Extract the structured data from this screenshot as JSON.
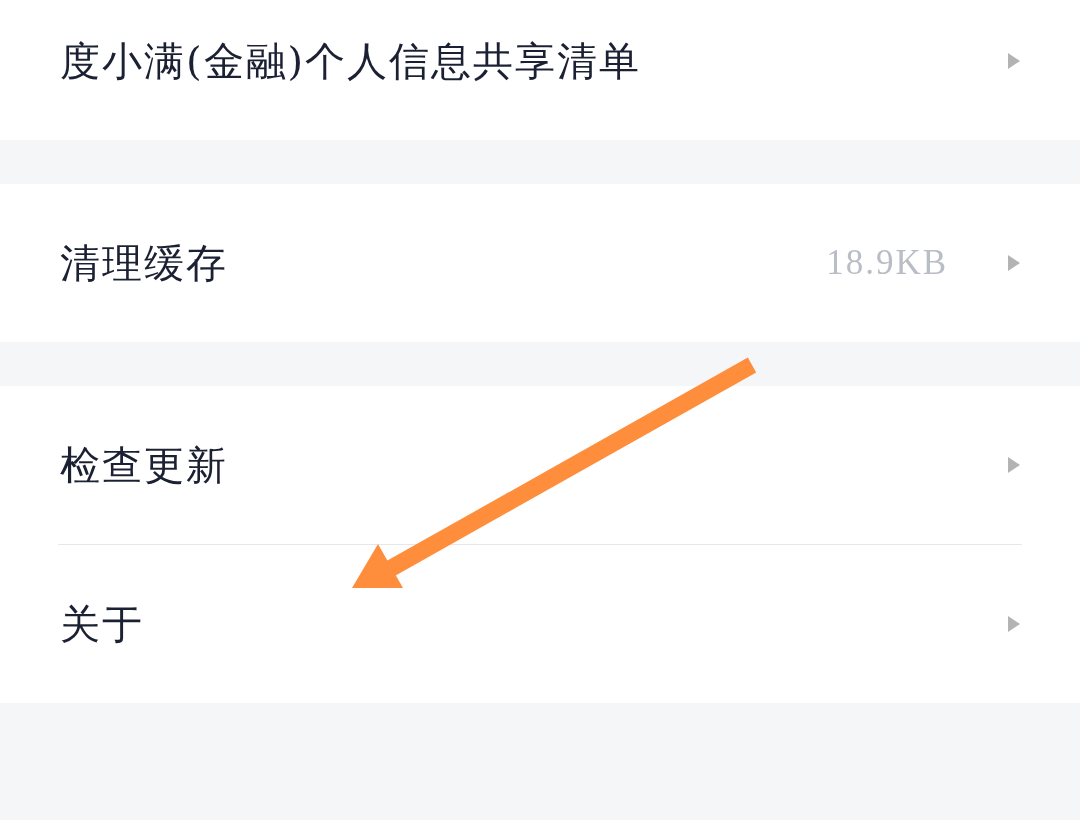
{
  "groups": [
    {
      "items": [
        {
          "label": "度小满(金融)个人信息共享清单"
        }
      ]
    },
    {
      "items": [
        {
          "label": "清理缓存",
          "value": "18.9KB"
        }
      ]
    },
    {
      "items": [
        {
          "label": "检查更新"
        },
        {
          "label": "关于"
        }
      ]
    }
  ]
}
